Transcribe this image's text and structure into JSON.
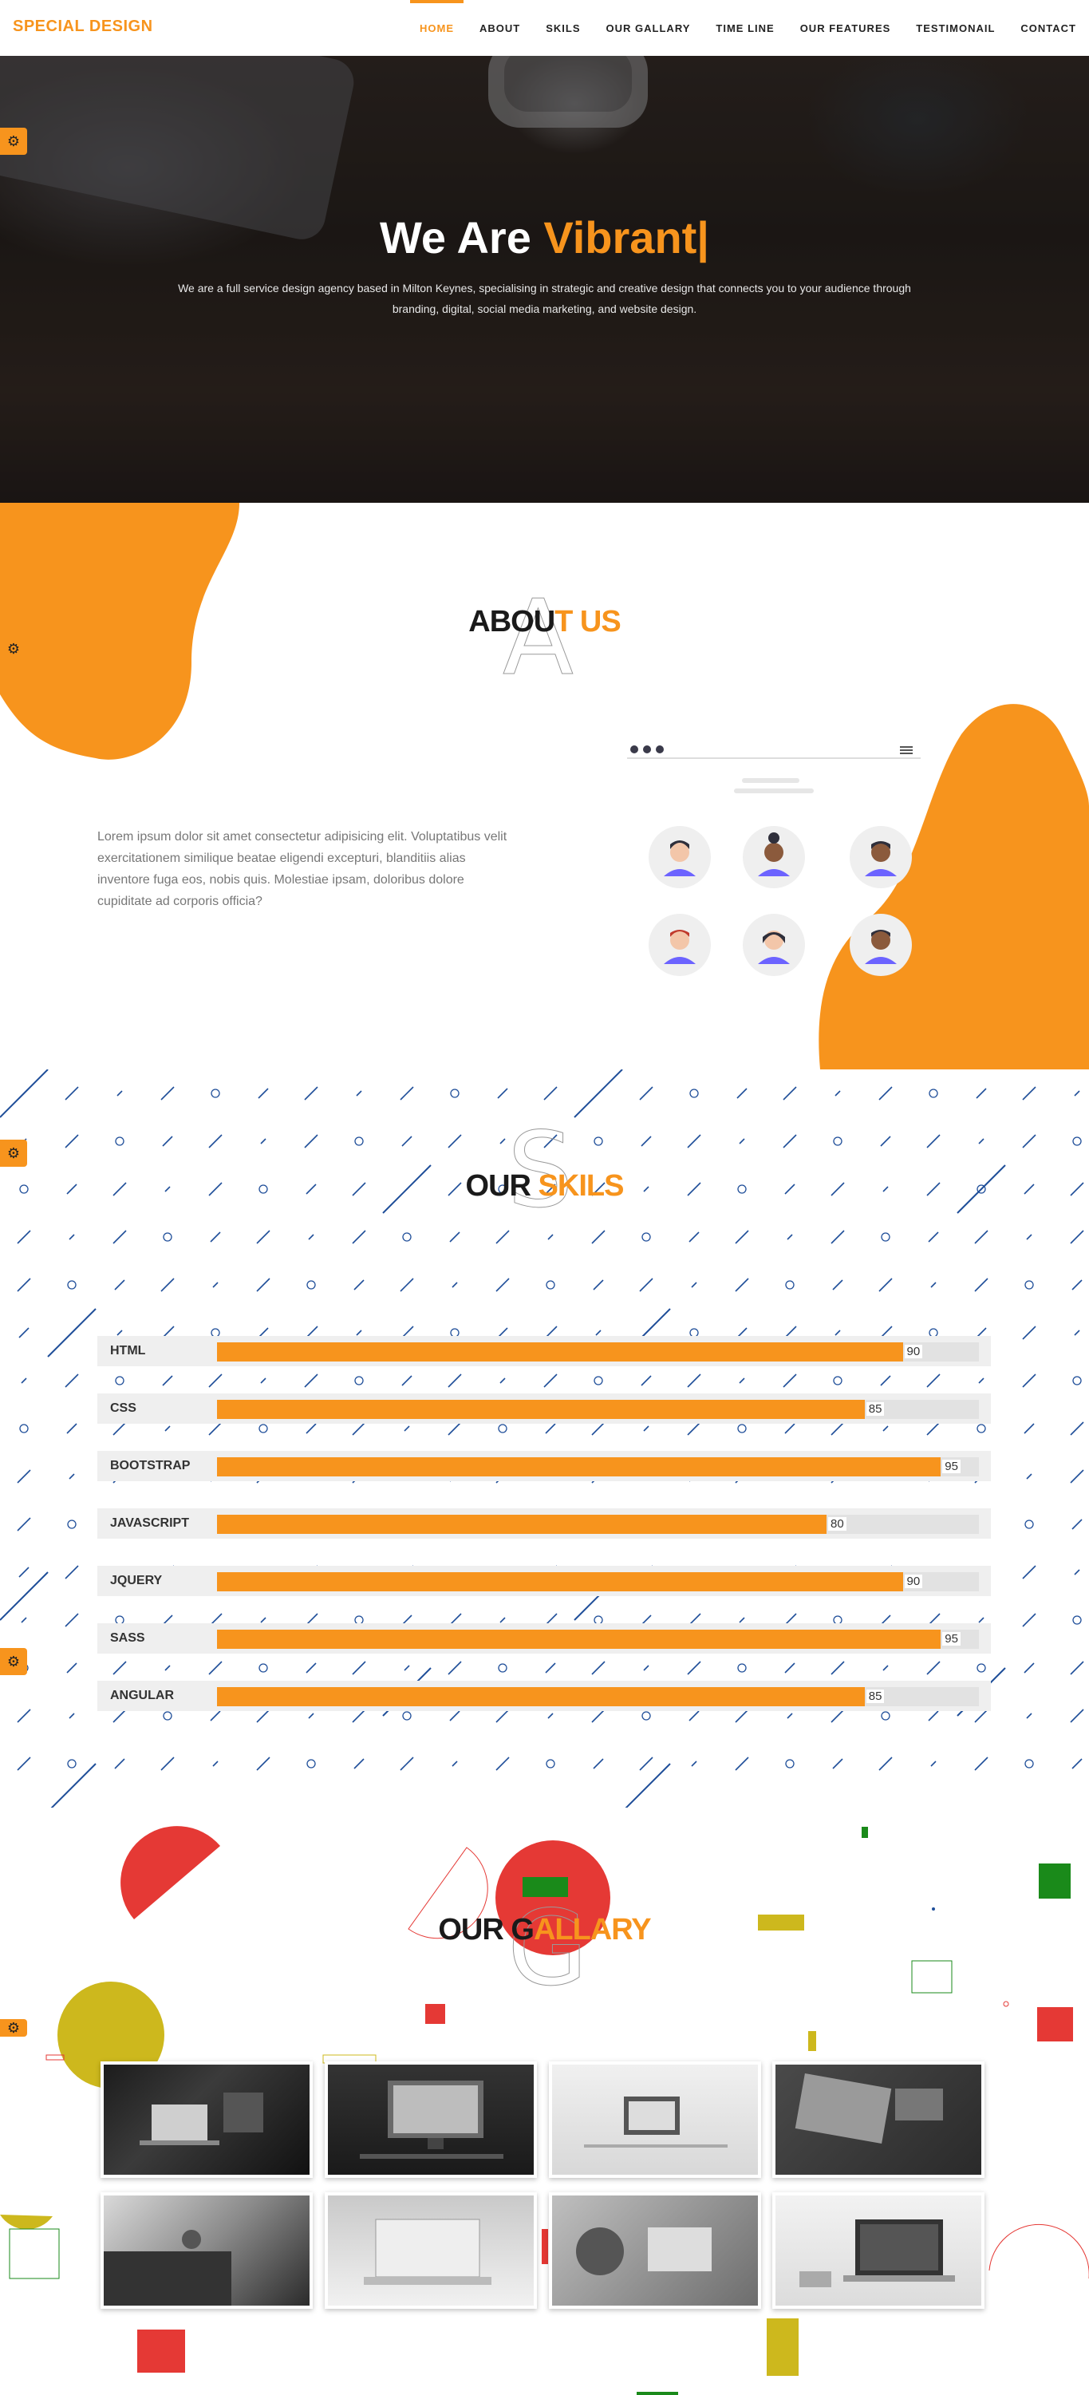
{
  "nav": {
    "logo": "SPECIAL DESIGN",
    "items": [
      {
        "label": "HOME"
      },
      {
        "label": "ABOUT"
      },
      {
        "label": "SKILS"
      },
      {
        "label": "OUR GALLARY"
      },
      {
        "label": "TIME LINE"
      },
      {
        "label": "OUR FEATURES"
      },
      {
        "label": "TESTIMONAIL"
      },
      {
        "label": "CONTACT"
      }
    ]
  },
  "hero": {
    "title_dark": "We Are ",
    "title_accent": "Vibrant|",
    "text": "We are a full service design agency based in Milton Keynes, specialising in strategic and creative design that connects you to your audience through branding, digital, social media marketing, and website design."
  },
  "about": {
    "title_dark": "ABOU",
    "title_accent": "T US",
    "ghost": "A",
    "text": "Lorem ipsum dolor sit amet consectetur adipisicing elit. Voluptatibus velit exercitationem similique beatae eligendi excepturi, blanditiis alias inventore fuga eos, nobis quis. Molestiae ipsam, doloribus dolore cupiditate ad corporis officia?"
  },
  "skills": {
    "title_dark": "OUR ",
    "title_accent": "SKILS",
    "ghost": "S",
    "items": [
      {
        "name": "HTML",
        "value": "90"
      },
      {
        "name": "CSS",
        "value": "85"
      },
      {
        "name": "BOOTSTRAP",
        "value": "95"
      },
      {
        "name": "JAVASCRIPT",
        "value": "80"
      },
      {
        "name": "JQUERY",
        "value": "90"
      },
      {
        "name": "SASS",
        "value": "95"
      },
      {
        "name": "ANGULAR",
        "value": "85"
      }
    ]
  },
  "gallery": {
    "title_dark": "OUR G",
    "title_accent": "ALLARY",
    "ghost": "G"
  },
  "colors": {
    "accent": "#f7941d",
    "dark": "#1a1a1a",
    "red": "#e53935",
    "green": "#1a8a1a",
    "yellow": "#cdb81d",
    "blue": "#1f4e99"
  },
  "icons": {
    "settings": "gear-icon",
    "menu": "hamburger-icon"
  }
}
